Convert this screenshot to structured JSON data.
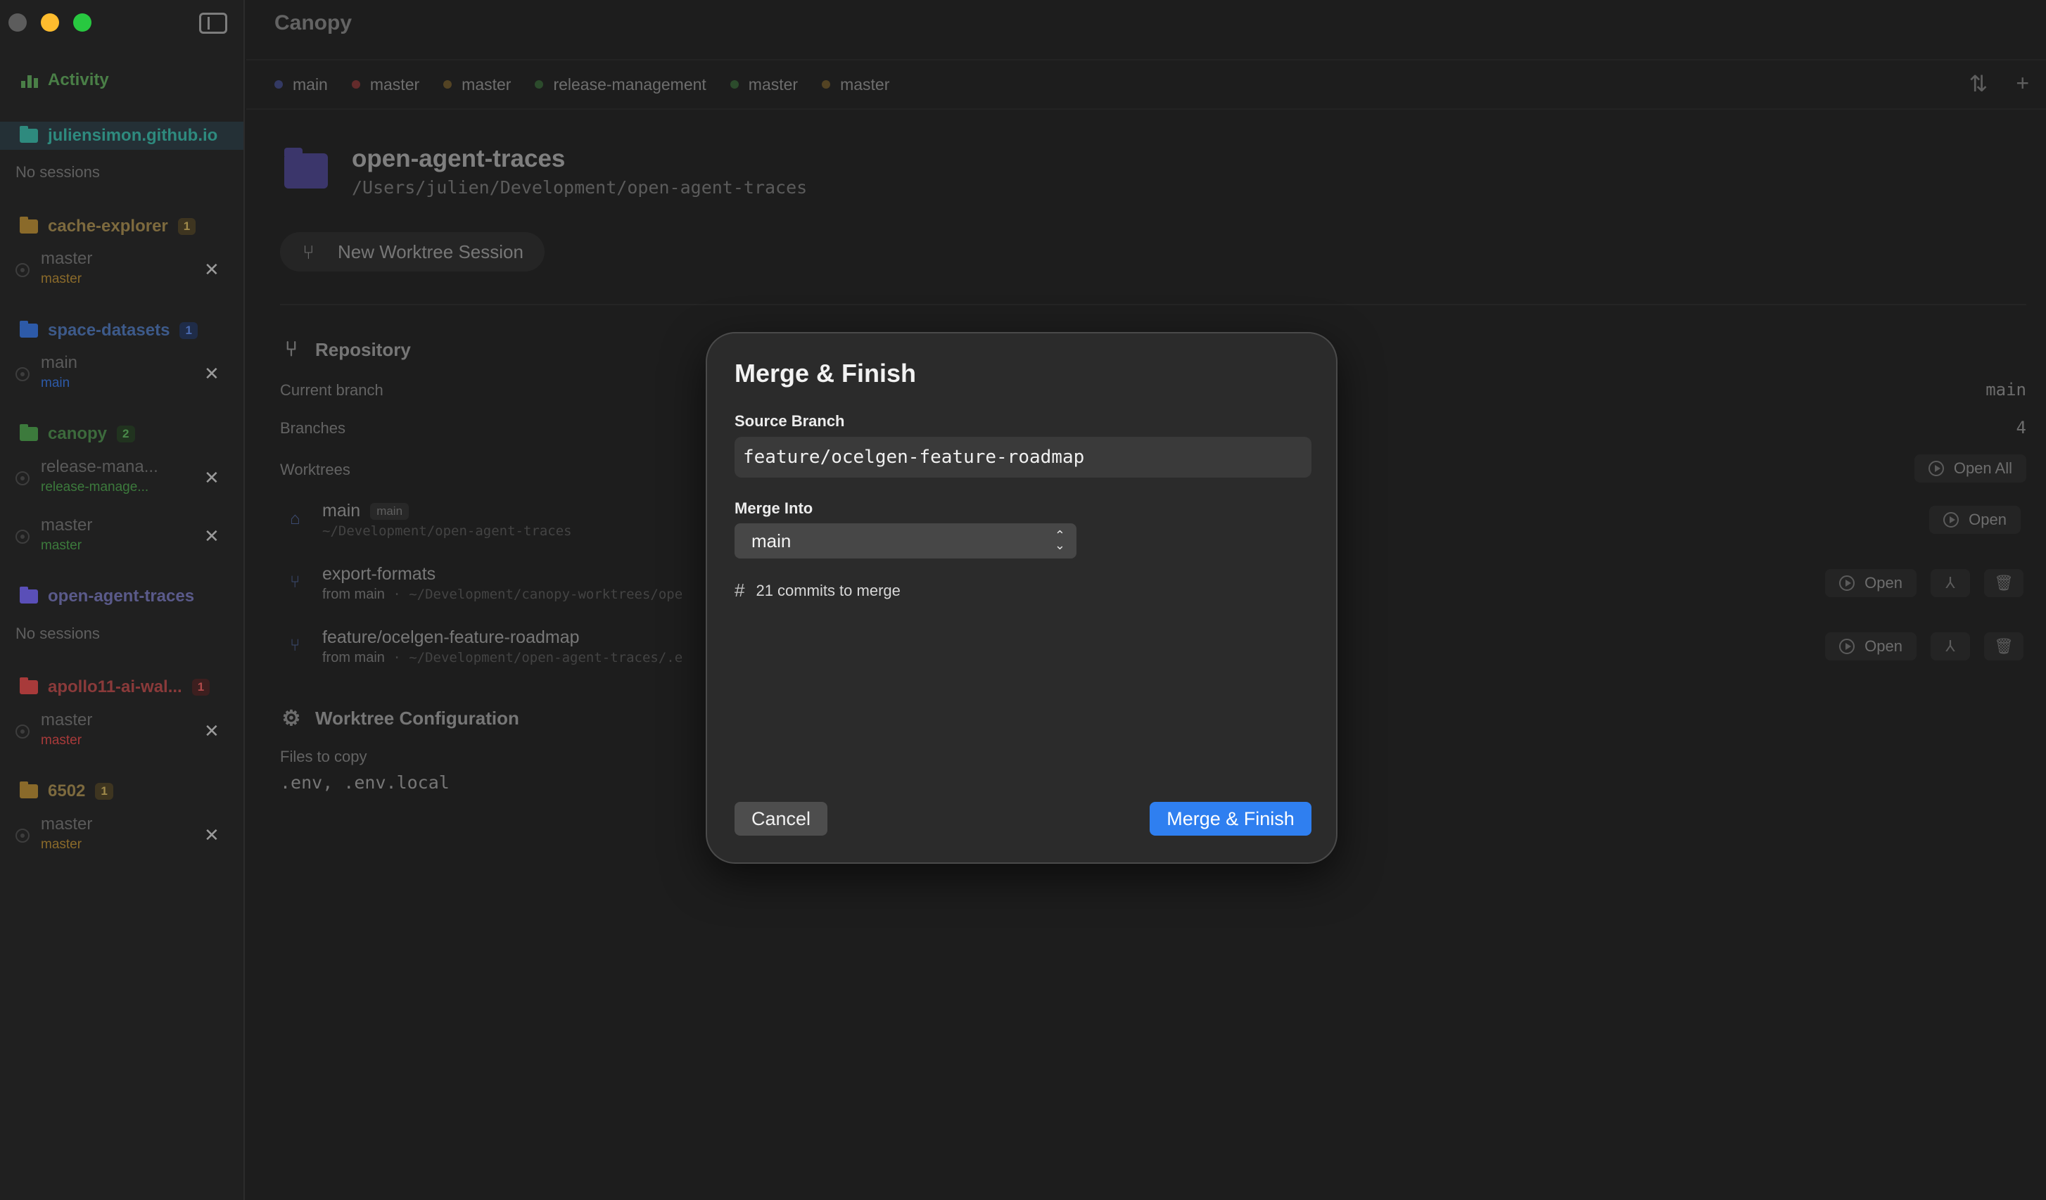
{
  "sidebar": {
    "activity_label": "Activity",
    "activity_color": "#4a7f47",
    "projects": [
      {
        "name": "juliensimon.github.io",
        "color": "#2e8a7e",
        "badge": "",
        "no_sessions": "No sessions",
        "sessions": []
      },
      {
        "name": "cache-explorer",
        "color": "#8a6a2a",
        "badge": "1",
        "sessions": [
          {
            "name": "master",
            "branch": "master"
          }
        ]
      },
      {
        "name": "space-datasets",
        "color": "#2d5aa8",
        "badge": "1",
        "sessions": [
          {
            "name": "main",
            "branch": "main"
          }
        ]
      },
      {
        "name": "canopy",
        "color": "#3c7a3c",
        "badge": "2",
        "sessions": [
          {
            "name": "release-mana...",
            "branch": "release-manage..."
          },
          {
            "name": "master",
            "branch": "master"
          }
        ]
      },
      {
        "name": "open-agent-traces",
        "color": "#5a4fb8",
        "badge": "",
        "no_sessions": "No sessions",
        "sessions": []
      },
      {
        "name": "apollo11-ai-wal...",
        "color": "#a83a3a",
        "badge": "1",
        "sessions": [
          {
            "name": "master",
            "branch": "master"
          }
        ]
      },
      {
        "name": "6502",
        "color": "#8a6a2a",
        "badge": "1",
        "sessions": [
          {
            "name": "master",
            "branch": "master"
          }
        ]
      }
    ]
  },
  "header": {
    "app_title": "Canopy",
    "tabs": [
      {
        "label": "main",
        "color": "#4a55a8"
      },
      {
        "label": "master",
        "color": "#a83a3a"
      },
      {
        "label": "master",
        "color": "#8a6a2a"
      },
      {
        "label": "release-management",
        "color": "#3c7a3c"
      },
      {
        "label": "master",
        "color": "#3c7a3c"
      },
      {
        "label": "master",
        "color": "#8a6a2a"
      }
    ],
    "sort_glyph": "⇅",
    "add_glyph": "+"
  },
  "repo": {
    "name": "open-agent-traces",
    "path": "/Users/julien/Development/open-agent-traces",
    "new_session_label": "New Worktree Session",
    "repository_title": "Repository",
    "current_branch_label": "Current branch",
    "current_branch_value": "main",
    "branches_label": "Branches",
    "branches_value": "4",
    "worktrees_label": "Worktrees",
    "open_all_label": "Open All",
    "open_label": "Open",
    "worktrees": [
      {
        "name": "main",
        "tag": "main",
        "sub_prefix": "",
        "sub_path": "~/Development/open-agent-traces"
      },
      {
        "name": "export-formats",
        "tag": "",
        "sub_prefix": "from main",
        "sub_path": " · ~/Development/canopy-worktrees/ope"
      },
      {
        "name": "feature/ocelgen-feature-roadmap",
        "tag": "",
        "sub_prefix": "from main",
        "sub_path": " · ~/Development/open-agent-traces/.e"
      }
    ],
    "config_title": "Worktree Configuration",
    "files_label": "Files to copy",
    "files_value": ".env, .env.local"
  },
  "modal": {
    "title": "Merge & Finish",
    "source_label": "Source Branch",
    "source_value": "feature/ocelgen-feature-roadmap",
    "merge_into_label": "Merge Into",
    "merge_into_value": "main",
    "commits_text": "21 commits to merge",
    "cancel_label": "Cancel",
    "confirm_label": "Merge & Finish",
    "confirm_color": "#2f7ff0"
  }
}
